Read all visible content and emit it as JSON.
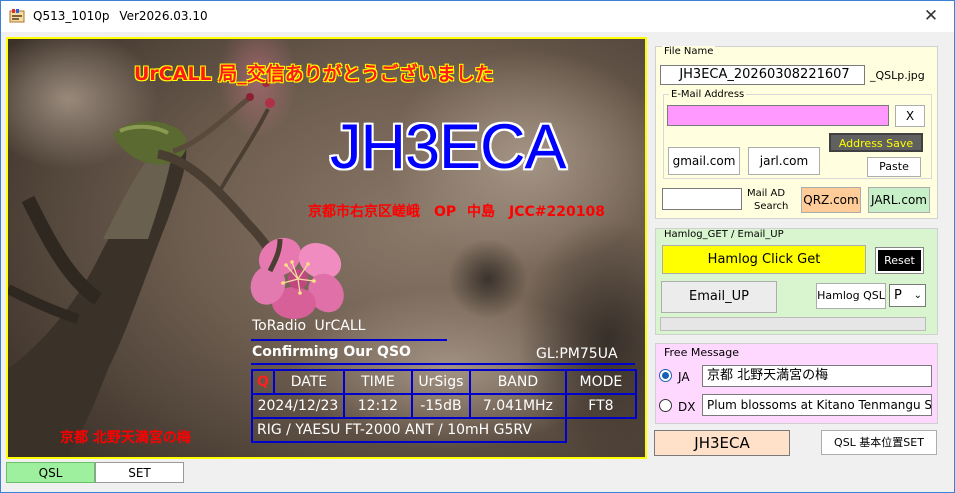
{
  "window": {
    "title": "Q513_1010p   Ver2026.03.10",
    "close_glyph": "✕"
  },
  "card": {
    "greeting": "UrCALL  局_交信ありがとうございました",
    "callsign": "JH3ECA",
    "qth": "京都市右京区嵯峨　OP 中島　JCC#220108",
    "photo_caption": "京都 北野天満宮の梅",
    "to_radio": "ToRadio  UrCALL",
    "confirming": "Confirming Our QSO",
    "grid": "GL:PM75UA",
    "table": {
      "q": "Q",
      "headers": [
        "DATE",
        "TIME",
        "UrSigs",
        "BAND",
        "MODE"
      ],
      "values": [
        "2024/12/23",
        "12:12",
        "-15dB",
        "7.041MHz",
        "FT8"
      ],
      "footer": "RIG / YAESU  FT-2000   ANT / 10mH G5RV"
    }
  },
  "file": {
    "legend": "File Name",
    "name_value": "JH3ECA_20260308221607",
    "suffix": "_QSLp.jpg",
    "mail_legend": "E-Mail Address",
    "email_value": "",
    "clear_label": "X",
    "address_save_label": "Address Save",
    "gmail_label": "gmail.com",
    "jarl_label": "jarl.com",
    "paste_label": "Paste",
    "mail_ad_search_value": "",
    "mail_ad_search_label1": "Mail AD",
    "mail_ad_search_label2": "Search",
    "qrz_label": "QRZ.com",
    "jarl_com_label": "JARL.com"
  },
  "hamlog": {
    "legend": "Hamlog_GET / Email_UP",
    "click_get_label": "Hamlog Click Get",
    "reset_label": "Reset",
    "email_up_label": "Email_UP",
    "hamlog_qsl_label": "Hamlog QSL",
    "qsl_select_value": "P",
    "progress": 0
  },
  "message": {
    "legend": "Free Message",
    "ja_label": "JA",
    "dx_label": "DX",
    "ja_value": "京都 北野天満宮の梅",
    "dx_value": "Plum blossoms at Kitano Tenmangu S",
    "ja_selected": true
  },
  "bottom": {
    "callsign_display": "JH3ECA",
    "qsl_pos_set_label": "QSL 基本位置SET"
  },
  "tabs": [
    {
      "label": "QSL",
      "active": true
    },
    {
      "label": "SET",
      "active": false
    }
  ],
  "colors": {
    "title_bar_border": "#3b82d6",
    "card_border": "#ffff00",
    "callsign_text": "#0000ff",
    "greeting_text": "#ff1a1a",
    "file_panel": "#ffffe0",
    "hamlog_panel": "#d8f5d0",
    "message_panel": "#ffd8ff",
    "hamlog_get_button": "#ffff00",
    "reset_button": "#000000",
    "qrz_button": "#ffcc99",
    "jarl_button": "#c8f0c8",
    "email_field": "#ff99ff",
    "callsign_display": "#ffe0c8"
  }
}
